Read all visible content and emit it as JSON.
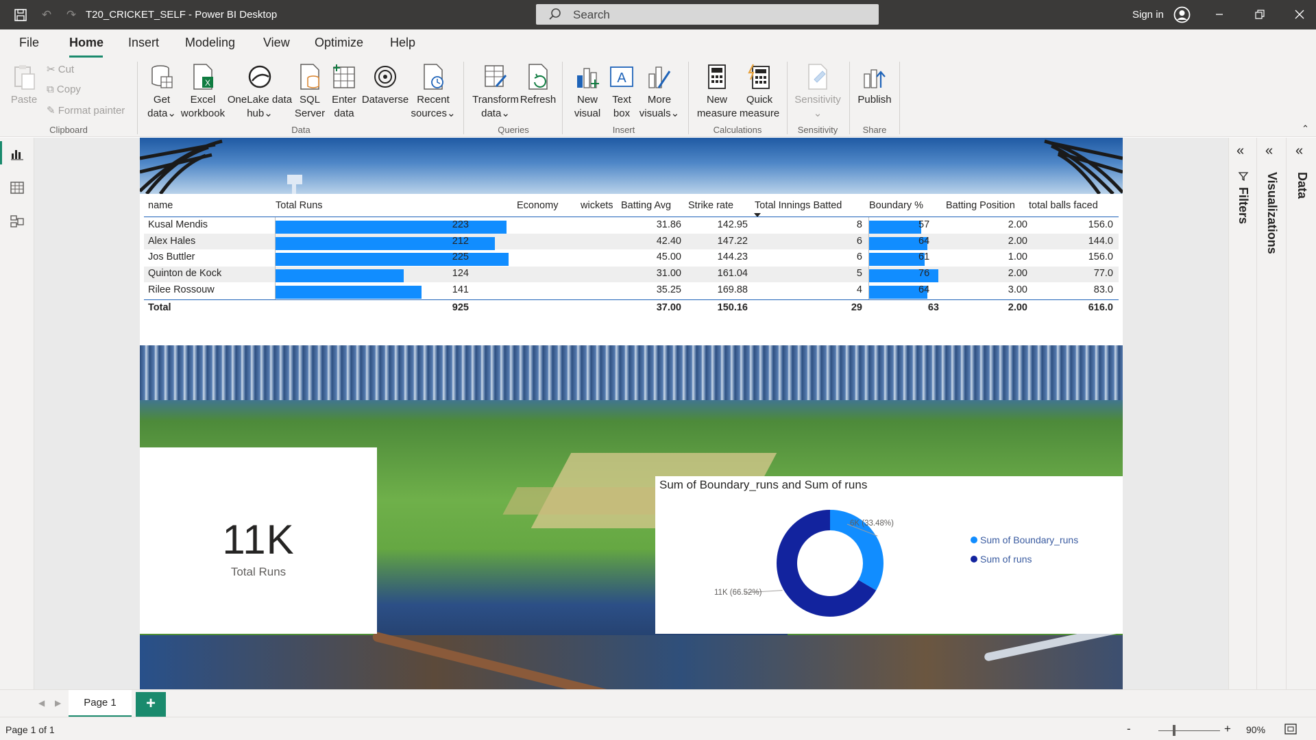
{
  "titlebar": {
    "title": "T20_CRICKET_SELF - Power BI Desktop",
    "search_placeholder": "Search",
    "signin": "Sign in"
  },
  "ribbon_tabs": [
    "File",
    "Home",
    "Insert",
    "Modeling",
    "View",
    "Optimize",
    "Help"
  ],
  "clipboard": {
    "paste": "Paste",
    "cut": "Cut",
    "copy": "Copy",
    "format_painter": "Format painter",
    "group": "Clipboard"
  },
  "data_group": {
    "get_data_1": "Get",
    "get_data_2": "data",
    "excel_1": "Excel",
    "excel_2": "workbook",
    "onelake_1": "OneLake data",
    "onelake_2": "hub",
    "sql_1": "SQL",
    "sql_2": "Server",
    "enter_1": "Enter",
    "enter_2": "data",
    "dataverse": "Dataverse",
    "recent_1": "Recent",
    "recent_2": "sources",
    "group": "Data"
  },
  "queries_group": {
    "transform_1": "Transform",
    "transform_2": "data",
    "refresh": "Refresh",
    "group": "Queries"
  },
  "insert_group": {
    "new_visual_1": "New",
    "new_visual_2": "visual",
    "text_box_1": "Text",
    "text_box_2": "box",
    "more_visuals_1": "More",
    "more_visuals_2": "visuals",
    "group": "Insert"
  },
  "calculations_group": {
    "new_measure_1": "New",
    "new_measure_2": "measure",
    "quick_measure_1": "Quick",
    "quick_measure_2": "measure",
    "group": "Calculations"
  },
  "sensitivity_group": {
    "sensitivity": "Sensitivity",
    "group": "Sensitivity"
  },
  "share_group": {
    "publish": "Publish",
    "group": "Share"
  },
  "table": {
    "headers": [
      "name",
      "Total Runs",
      "Economy",
      "wickets",
      "Batting Avg",
      "Strike rate",
      "Total Innings Batted",
      "Boundary %",
      "Batting Position",
      "total balls faced"
    ],
    "rows": [
      {
        "name": "Kusal Mendis",
        "total_runs": "223",
        "runs_value": 223,
        "economy": "",
        "wickets": "",
        "batting_avg": "31.86",
        "strike_rate": "142.95",
        "innings": "8",
        "boundary_pct": "57",
        "boundary_value": 57,
        "batting_position": "2.00",
        "balls_faced": "156.0"
      },
      {
        "name": "Alex Hales",
        "total_runs": "212",
        "runs_value": 212,
        "economy": "",
        "wickets": "",
        "batting_avg": "42.40",
        "strike_rate": "147.22",
        "innings": "6",
        "boundary_pct": "64",
        "boundary_value": 64,
        "batting_position": "2.00",
        "balls_faced": "144.0"
      },
      {
        "name": "Jos Buttler",
        "total_runs": "225",
        "runs_value": 225,
        "economy": "",
        "wickets": "",
        "batting_avg": "45.00",
        "strike_rate": "144.23",
        "innings": "6",
        "boundary_pct": "61",
        "boundary_value": 61,
        "batting_position": "1.00",
        "balls_faced": "156.0"
      },
      {
        "name": "Quinton de Kock",
        "total_runs": "124",
        "runs_value": 124,
        "economy": "",
        "wickets": "",
        "batting_avg": "31.00",
        "strike_rate": "161.04",
        "innings": "5",
        "boundary_pct": "76",
        "boundary_value": 76,
        "batting_position": "2.00",
        "balls_faced": "77.0"
      },
      {
        "name": "Rilee Rossouw",
        "total_runs": "141",
        "runs_value": 141,
        "economy": "",
        "wickets": "",
        "batting_avg": "35.25",
        "strike_rate": "169.88",
        "innings": "4",
        "boundary_pct": "64",
        "boundary_value": 64,
        "batting_position": "3.00",
        "balls_faced": "83.0"
      }
    ],
    "total": {
      "name": "Total",
      "total_runs": "925",
      "batting_avg": "37.00",
      "strike_rate": "150.16",
      "innings": "29",
      "boundary_pct": "63",
      "batting_position": "2.00",
      "balls_faced": "616.0"
    }
  },
  "card": {
    "value": "11K",
    "label": "Total Runs"
  },
  "donut": {
    "title": "Sum of Boundary_runs and Sum of runs",
    "label_boundary": "6K (33.48%)",
    "label_runs": "11K (66.52%)",
    "legend": [
      "Sum of Boundary_runs",
      "Sum of runs"
    ]
  },
  "chart_data": {
    "type": "pie",
    "title": "Sum of Boundary_runs and Sum of runs",
    "categories": [
      "Sum of Boundary_runs",
      "Sum of runs"
    ],
    "values": [
      33.48,
      66.52
    ],
    "value_labels": [
      "6K (33.48%)",
      "11K (66.52%)"
    ],
    "colors": [
      "#118dff",
      "#12239e"
    ],
    "legend": "right"
  },
  "panes": {
    "filters": "Filters",
    "visualizations": "Visualizations",
    "data": "Data"
  },
  "pages": {
    "tab": "Page 1",
    "add": "+"
  },
  "status": {
    "page_info": "Page 1 of 1",
    "zoom": "90%",
    "zoom_minus": "-",
    "zoom_plus": "+"
  },
  "colors": {
    "accent": "#1a8a6d",
    "bar": "#118dff",
    "dark_series": "#12239e",
    "titlebar": "#3b3a39"
  }
}
